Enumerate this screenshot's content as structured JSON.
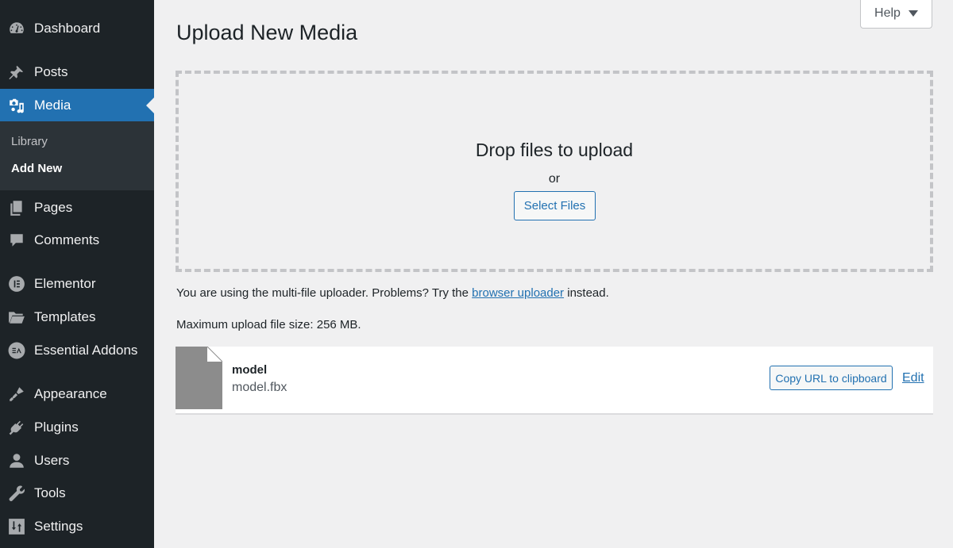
{
  "sidebar": {
    "items": [
      {
        "label": "Dashboard",
        "icon": "dashboard-icon"
      },
      {
        "label": "Posts",
        "icon": "pin-icon"
      },
      {
        "label": "Media",
        "icon": "media-icon",
        "active": true
      },
      {
        "label": "Pages",
        "icon": "pages-icon"
      },
      {
        "label": "Comments",
        "icon": "comment-icon"
      },
      {
        "label": "Elementor",
        "icon": "elementor-icon"
      },
      {
        "label": "Templates",
        "icon": "folder-icon"
      },
      {
        "label": "Essential Addons",
        "icon": "essential-addons-icon"
      },
      {
        "label": "Appearance",
        "icon": "paintbrush-icon"
      },
      {
        "label": "Plugins",
        "icon": "plug-icon"
      },
      {
        "label": "Users",
        "icon": "user-icon"
      },
      {
        "label": "Tools",
        "icon": "wrench-icon"
      },
      {
        "label": "Settings",
        "icon": "settings-sliders-icon"
      }
    ],
    "submenu": [
      {
        "label": "Library"
      },
      {
        "label": "Add New",
        "current": true
      }
    ],
    "accent_color": "#2271b1",
    "background_color": "#1d2327"
  },
  "header": {
    "help_label": "Help",
    "page_title": "Upload New Media"
  },
  "uploader": {
    "drop_text": "Drop files to upload",
    "or_text": "or",
    "select_files_label": "Select Files",
    "info_prefix": "You are using the multi-file uploader. Problems? Try the ",
    "info_link": "browser uploader",
    "info_suffix": " instead.",
    "max_size_text": "Maximum upload file size: 256 MB."
  },
  "media_items": [
    {
      "title": "model",
      "filename": "model.fbx",
      "copy_url_label": "Copy URL to clipboard",
      "edit_label": "Edit"
    }
  ]
}
